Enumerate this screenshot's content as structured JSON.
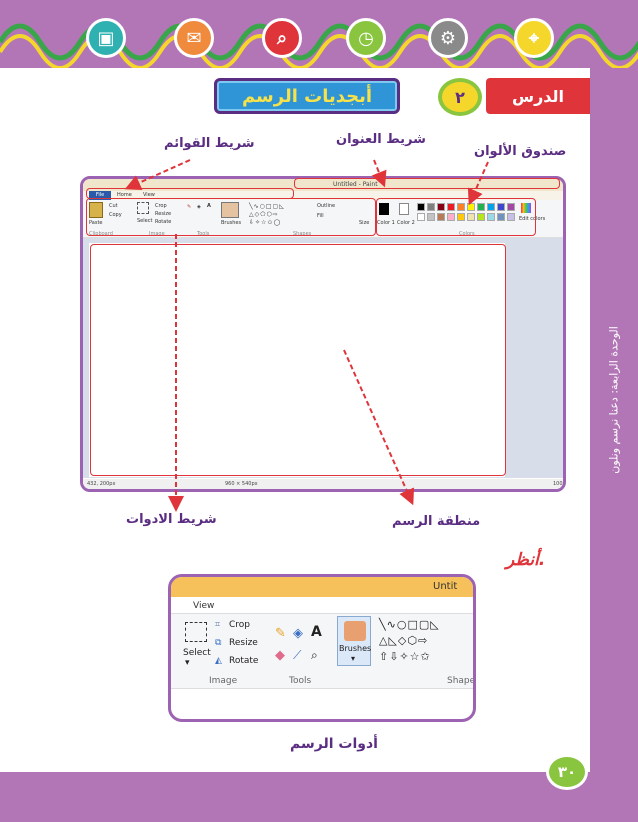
{
  "header": {
    "icons": [
      "briefcase-icon",
      "mail-icon",
      "search-icon",
      "clock-icon",
      "gears-icon",
      "location-pin-icon"
    ]
  },
  "lesson": {
    "label": "الدرس",
    "number": "٢",
    "title": "أبجديات الرسم"
  },
  "sidebar": {
    "unit_text": "الوحدة الرابعة: دعنا نرسم ونلون"
  },
  "labels": {
    "menu_bar": "شريط القوائم",
    "title_bar": "شريط العنوان",
    "color_box": "صندوق الألوان",
    "tools_bar": "شريط الادوات",
    "drawing_area": "منطقة الرسم",
    "look": "أنظر.",
    "drawing_tools": "أدوات الرسم"
  },
  "paint_window": {
    "title": "Untitled - Paint",
    "tabs": [
      "File",
      "Home",
      "View"
    ],
    "ribbon": {
      "paste": "Paste",
      "cut": "Cut",
      "copy": "Copy",
      "select": "Select",
      "crop": "Crop",
      "resize": "Resize",
      "rotate": "Rotate",
      "brushes": "Brushes",
      "outline": "Outline",
      "fill": "Fill",
      "size": "Size",
      "color1": "Color 1",
      "color2": "Color 2",
      "edit_colors": "Edit colors",
      "groups": [
        "Clipboard",
        "Image",
        "Tools",
        "Shapes",
        "Colors"
      ]
    },
    "status": {
      "coords": "432, 200px",
      "dimensions": "960 × 540px",
      "zoom": "100"
    },
    "palette": [
      "#000000",
      "#7f7f7f",
      "#880015",
      "#ed1c24",
      "#ff7f27",
      "#fff200",
      "#22b14c",
      "#00a2e8",
      "#3f48cc",
      "#a349a4",
      "#ffffff",
      "#c3c3c3",
      "#b97a57",
      "#ffaec9",
      "#ffc90e",
      "#efe4b0",
      "#b5e61d",
      "#99d9ea",
      "#7092be",
      "#c8bfe7"
    ]
  },
  "tools_window": {
    "title": "Untit",
    "tab": "View",
    "select": "Select",
    "crop": "Crop",
    "resize": "Resize",
    "rotate": "Rotate",
    "brushes": "Brushes",
    "groups": [
      "Image",
      "Tools",
      "Shapes"
    ]
  },
  "page_number": "٣٠",
  "colors": {
    "purple": "#b276b7",
    "dark_purple": "#5a2d82",
    "red": "#e0343b",
    "green": "#8ac540",
    "yellow": "#f5d72c",
    "blue": "#2f95d6"
  }
}
